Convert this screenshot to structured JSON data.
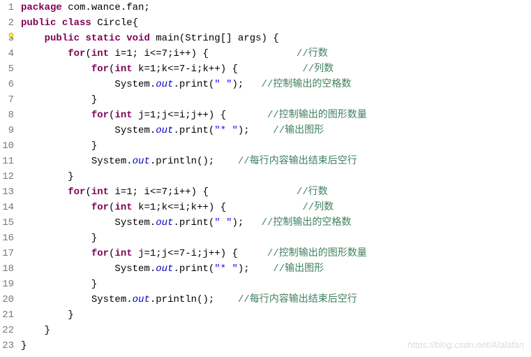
{
  "lineNumbers": [
    "1",
    "2",
    "3",
    "4",
    "5",
    "6",
    "7",
    "8",
    "9",
    "10",
    "11",
    "12",
    "13",
    "14",
    "15",
    "16",
    "17",
    "18",
    "19",
    "20",
    "21",
    "22",
    "23"
  ],
  "code": {
    "l1": {
      "kw1": "package",
      "pkg": " com.wance.fan;"
    },
    "l2": {
      "kw1": "public",
      "kw2": "class",
      "name": " Circle{"
    },
    "l3": {
      "kw1": "public",
      "kw2": "static",
      "kw3": "void",
      "sig": " main(String[] args) {"
    },
    "l4": {
      "kw1": "for",
      "p1": "(",
      "kw2": "int",
      "p2": " i=1; i<=7;i++) {",
      "c": "//行数"
    },
    "l5": {
      "kw1": "for",
      "p1": "(",
      "kw2": "int",
      "p2": " k=1;k<=7-i;k++) {",
      "c": "//列数"
    },
    "l6": {
      "p1": "System.",
      "f": "out",
      "p2": ".print(",
      "s": "\" \"",
      "p3": ");",
      "c": "//控制输出的空格数"
    },
    "l7": {
      "p": "}"
    },
    "l8": {
      "kw1": "for",
      "p1": "(",
      "kw2": "int",
      "p2": " j=1;j<=i;j++) {",
      "c": "//控制输出的图形数量"
    },
    "l9": {
      "p1": "System.",
      "f": "out",
      "p2": ".print(",
      "s": "\"* \"",
      "p3": ");",
      "c": "//输出图形"
    },
    "l10": {
      "p": "}"
    },
    "l11": {
      "p1": "System.",
      "f": "out",
      "p2": ".println();",
      "c": "//每行内容输出结束后空行"
    },
    "l12": {
      "p": "}"
    },
    "l13": {
      "kw1": "for",
      "p1": "(",
      "kw2": "int",
      "p2": " i=1; i<=7;i++) {",
      "c": "//行数"
    },
    "l14": {
      "kw1": "for",
      "p1": "(",
      "kw2": "int",
      "p2": " k=1;k<=i;k++) {",
      "c": "//列数"
    },
    "l15": {
      "p1": "System.",
      "f": "out",
      "p2": ".print(",
      "s": "\" \"",
      "p3": ");",
      "c": "//控制输出的空格数"
    },
    "l16": {
      "p": "}"
    },
    "l17": {
      "kw1": "for",
      "p1": "(",
      "kw2": "int",
      "p2": " j=1;j<=7-i;j++) {",
      "c": "//控制输出的图形数量"
    },
    "l18": {
      "p1": "System.",
      "f": "out",
      "p2": ".print(",
      "s": "\"* \"",
      "p3": ");",
      "c": "//输出图形"
    },
    "l19": {
      "p": "}"
    },
    "l20": {
      "p1": "System.",
      "f": "out",
      "p2": ".println();",
      "c": "//每行内容输出结束后空行"
    },
    "l21": {
      "p": "}"
    },
    "l22": {
      "p": "}"
    },
    "l23": {
      "p": "}"
    }
  },
  "watermark": "https://blog.csdn.net/Alalafan"
}
